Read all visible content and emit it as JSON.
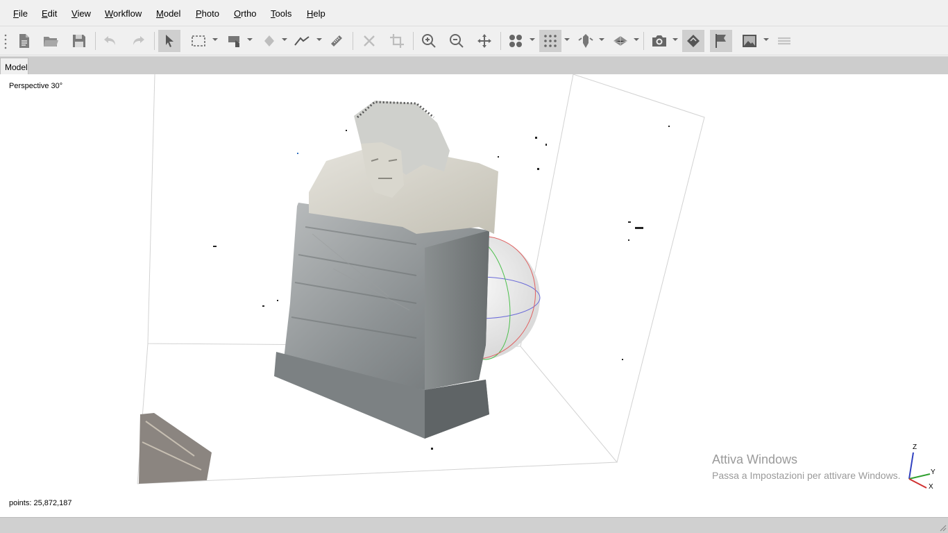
{
  "menu": {
    "file": {
      "mn": "F",
      "rest": "ile"
    },
    "edit": {
      "mn": "E",
      "rest": "dit"
    },
    "view": {
      "mn": "V",
      "rest": "iew"
    },
    "workflow": {
      "mn": "W",
      "rest": "orkflow"
    },
    "model": {
      "mn": "M",
      "rest": "odel"
    },
    "photo": {
      "mn": "P",
      "rest": "hoto"
    },
    "ortho": {
      "mn": "O",
      "rest": "rtho"
    },
    "tools": {
      "mn": "T",
      "rest": "ools"
    },
    "help": {
      "mn": "H",
      "rest": "elp"
    }
  },
  "toolbar": {
    "icons": [
      "new-document-icon",
      "open-folder-icon",
      "save-disk-icon",
      "undo-icon",
      "redo-icon",
      "navigation-arrow-icon",
      "rectangle-selection-icon",
      "draw-shape-icon",
      "fill-icon",
      "ruler-icon",
      "measure-icon",
      "delete-icon",
      "crop-icon",
      "zoom-in-icon",
      "zoom-out-icon",
      "move-object-icon",
      "points-icon",
      "dense-points-icon",
      "tiled-model-icon",
      "mesh-icon",
      "camera-icon",
      "shape-show-icon",
      "marker-flag-icon",
      "image-icon",
      "layers-icon"
    ]
  },
  "tabs": {
    "model": "Model"
  },
  "viewport": {
    "perspective": "Perspective 30°",
    "points": "points: 25,872,187",
    "axis_z": "Z",
    "axis_y": "Y",
    "axis_x": "X"
  },
  "watermark": {
    "title": "Attiva Windows",
    "subtitle": "Passa a Impostazioni per attivare Windows."
  },
  "colors": {
    "toolbar_bg": "#f0f0f0",
    "active_button": "#cfcfcf",
    "tabbar_bg": "#cdcdcd",
    "statusbar_bg": "#d0d0d0",
    "axis_x": "#d03030",
    "axis_y": "#30a030",
    "axis_z": "#3040c0"
  }
}
